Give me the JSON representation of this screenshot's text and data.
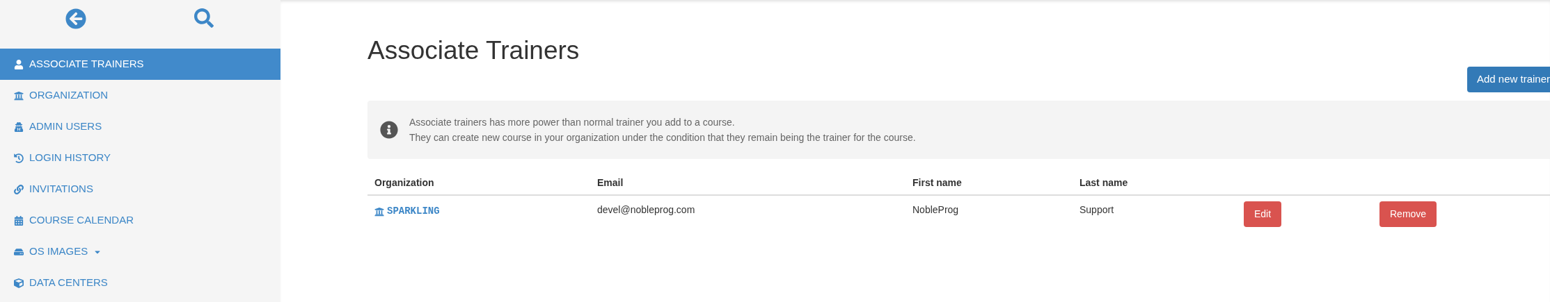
{
  "sidebar": {
    "items": [
      {
        "label": "ASSOCIATE TRAINERS",
        "selected": true,
        "kind": "link"
      },
      {
        "label": "ORGANIZATION",
        "selected": false,
        "kind": "link"
      },
      {
        "label": "ADMIN USERS",
        "selected": false,
        "kind": "link"
      },
      {
        "label": "LOGIN HISTORY",
        "selected": false,
        "kind": "link"
      },
      {
        "label": "INVITATIONS",
        "selected": false,
        "kind": "link"
      },
      {
        "label": "COURSE CALENDAR",
        "selected": false,
        "kind": "link"
      },
      {
        "label": "OS IMAGES",
        "selected": false,
        "kind": "dropdown"
      },
      {
        "label": "DATA CENTERS",
        "selected": false,
        "kind": "link"
      }
    ]
  },
  "page": {
    "title": "Associate Trainers",
    "add_button": "Add new trainer",
    "info": [
      "Associate trainers has more power than normal trainer you add to a course.",
      "They can create new course in your organization under the condition that they remain being the trainer for the course."
    ]
  },
  "table": {
    "columns": [
      "Organization",
      "Email",
      "First name",
      "Last name"
    ],
    "rows": [
      {
        "organization": "SPARKLING",
        "email": "devel@nobleprog.com",
        "first_name": "NobleProg",
        "last_name": "Support",
        "actions": [
          "Edit",
          "Remove"
        ]
      }
    ]
  }
}
